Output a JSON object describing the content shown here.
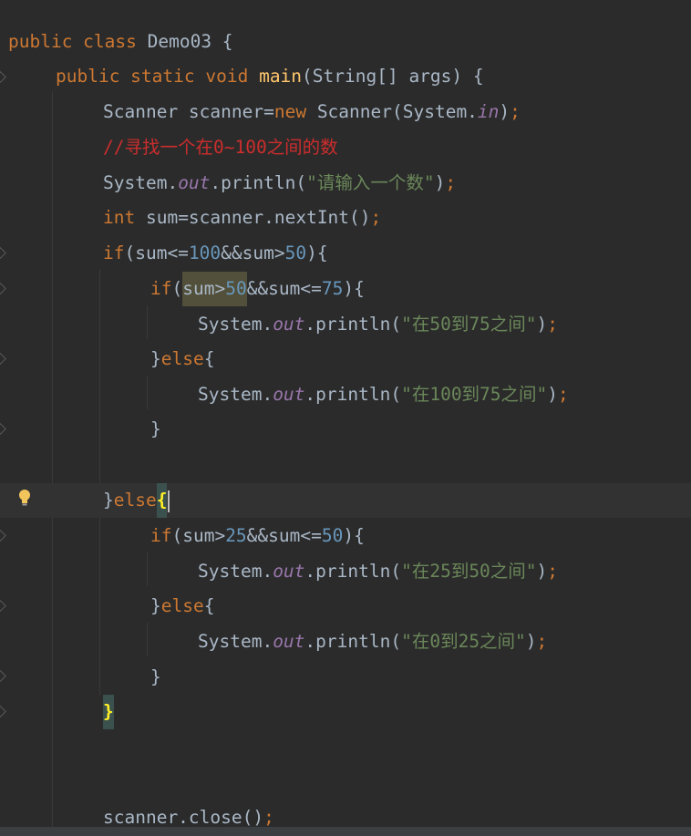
{
  "editor": {
    "language": "java",
    "colors": {
      "background": "#2b2b2b",
      "current_line": "#323232",
      "keyword": "#cc7832",
      "method_declaration": "#ffc66d",
      "number": "#6897bb",
      "string": "#6a8759",
      "comment": "#cc2d2d",
      "static_field": "#9876aa",
      "default_text": "#a9b7c6",
      "usage_highlight": "#52503a",
      "brace_match": "#3b514d"
    },
    "gutter_icon": "lightbulb-icon",
    "code": {
      "l1": {
        "kw": "public class",
        "rest": " Demo03 {"
      },
      "l2": {
        "kw": "public static void",
        "fn": "main",
        "rest": "(String[] args) {"
      },
      "l3": {
        "a": "Scanner scanner=",
        "kw": "new",
        "b": " Scanner(System.",
        "field": "in",
        "c": ")",
        "semi": ";"
      },
      "l4": {
        "comment": "//寻找一个在0~100之间的数"
      },
      "l5": {
        "a": "System.",
        "field": "out",
        "b": ".println(",
        "str": "\"请输入一个数\"",
        "c": ")",
        "semi": ";"
      },
      "l6": {
        "kw": "int",
        "a": " sum=scanner.nextInt()",
        "semi": ";"
      },
      "l7": {
        "kw": "if",
        "a": "(sum<=",
        "n1": "100",
        "b": "&&sum>",
        "n2": "50",
        "c": "){"
      },
      "l8": {
        "kw": "if",
        "a": "(",
        "hl_a": "sum>",
        "hl_n": "50",
        "b": "&&sum<=",
        "n2": "75",
        "c": "){"
      },
      "l9": {
        "a": "System.",
        "field": "out",
        "b": ".println(",
        "str": "\"在50到75之间\"",
        "c": ")",
        "semi": ";"
      },
      "l10": {
        "a": "}",
        "kw": "else",
        "b": "{"
      },
      "l11": {
        "a": "System.",
        "field": "out",
        "b": ".println(",
        "str": "\"在100到75之间\"",
        "c": ")",
        "semi": ";"
      },
      "l12": {
        "a": "}"
      },
      "l14": {
        "a": "}",
        "kw": "else",
        "brace": "{"
      },
      "l15": {
        "kw": "if",
        "a": "(sum>",
        "n1": "25",
        "b": "&&sum<=",
        "n2": "50",
        "c": "){"
      },
      "l16": {
        "a": "System.",
        "field": "out",
        "b": ".println(",
        "str": "\"在25到50之间\"",
        "c": ")",
        "semi": ";"
      },
      "l17": {
        "a": "}",
        "kw": "else",
        "b": "{"
      },
      "l18": {
        "a": "System.",
        "field": "out",
        "b": ".println(",
        "str": "\"在0到25之间\"",
        "c": ")",
        "semi": ";"
      },
      "l19": {
        "a": "}"
      },
      "l20": {
        "brace": "}"
      },
      "l23": {
        "a": "scanner.close()",
        "semi": ";"
      }
    }
  }
}
